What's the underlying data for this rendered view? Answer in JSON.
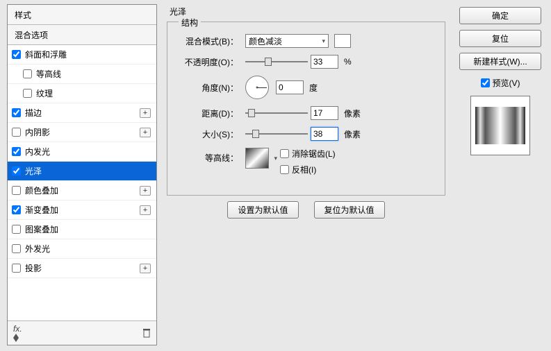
{
  "left": {
    "header": "样式",
    "subheader": "混合选项",
    "items": [
      {
        "label": "斜面和浮雕",
        "checked": true,
        "plus": false,
        "indent": false
      },
      {
        "label": "等高线",
        "checked": false,
        "plus": false,
        "indent": true
      },
      {
        "label": "纹理",
        "checked": false,
        "plus": false,
        "indent": true
      },
      {
        "label": "描边",
        "checked": true,
        "plus": true,
        "indent": false
      },
      {
        "label": "内阴影",
        "checked": false,
        "plus": true,
        "indent": false
      },
      {
        "label": "内发光",
        "checked": true,
        "plus": false,
        "indent": false
      },
      {
        "label": "光泽",
        "checked": true,
        "plus": false,
        "indent": false,
        "selected": true
      },
      {
        "label": "颜色叠加",
        "checked": false,
        "plus": true,
        "indent": false
      },
      {
        "label": "渐变叠加",
        "checked": true,
        "plus": true,
        "indent": false
      },
      {
        "label": "图案叠加",
        "checked": false,
        "plus": false,
        "indent": false
      },
      {
        "label": "外发光",
        "checked": false,
        "plus": false,
        "indent": false
      },
      {
        "label": "投影",
        "checked": false,
        "plus": true,
        "indent": false
      }
    ],
    "footer_fx": "fx"
  },
  "center": {
    "title": "光泽",
    "group": "结构",
    "blend_label": "混合模式(B)：",
    "blend_value": "颜色减淡",
    "opacity_label": "不透明度(O)：",
    "opacity_value": "33",
    "opacity_unit": "%",
    "angle_label": "角度(N)：",
    "angle_value": "0",
    "angle_unit": "度",
    "distance_label": "距离(D)：",
    "distance_value": "17",
    "distance_unit": "像素",
    "size_label": "大小(S)：",
    "size_value": "38",
    "size_unit": "像素",
    "contour_label": "等高线：",
    "antialias_label": "消除锯齿(L)",
    "invert_label": "反相(I)",
    "btn_default": "设置为默认值",
    "btn_reset": "复位为默认值"
  },
  "right": {
    "ok": "确定",
    "cancel": "复位",
    "newstyle": "新建样式(W)...",
    "preview_label": "预览(V)"
  }
}
